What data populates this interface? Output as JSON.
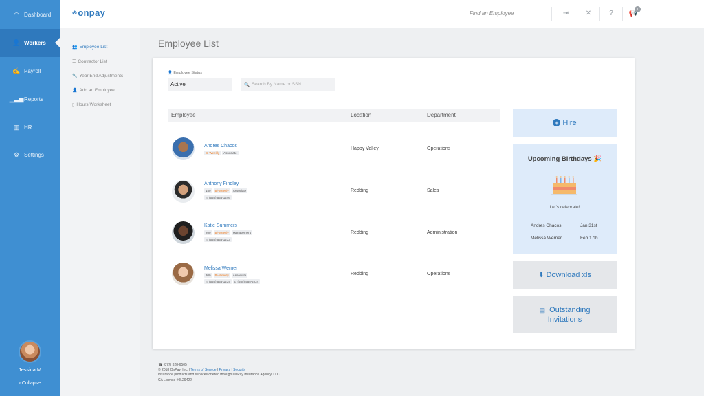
{
  "nav": {
    "items": [
      {
        "label": "Dashboard",
        "icon": "gauge-icon"
      },
      {
        "label": "Workers",
        "icon": "users-icon"
      },
      {
        "label": "Payroll",
        "icon": "payroll-icon"
      },
      {
        "label": "Reports",
        "icon": "chart-icon"
      },
      {
        "label": "HR",
        "icon": "books-icon"
      },
      {
        "label": "Settings",
        "icon": "gear-icon"
      }
    ],
    "active": "Workers",
    "user_name": "Jessica.M",
    "collapse_label": "«Collapse"
  },
  "subnav": {
    "items": [
      {
        "label": "Employee List",
        "icon": "users-icon"
      },
      {
        "label": "Contractor List",
        "icon": "list-icon"
      },
      {
        "label": "Year End Adjustments",
        "icon": "wrench-icon"
      },
      {
        "label": "Add an Employee",
        "icon": "user-plus-icon"
      },
      {
        "label": "Hours Worksheet",
        "icon": "file-icon"
      }
    ],
    "active": "Employee List"
  },
  "topbar": {
    "logo": "onpay",
    "search_placeholder": "Find an Employee",
    "notification_count": "1"
  },
  "main": {
    "title": "Employee List",
    "status_label": "Employee Status",
    "status_value": "Active",
    "search_placeholder": "Search By Name or SSN",
    "columns": [
      "Employee",
      "Location",
      "Department"
    ]
  },
  "employees": [
    {
      "name": "Andres Chacos",
      "tags": [
        "Bi-Weekly",
        "Associate"
      ],
      "phones": [],
      "location": "Happy Valley",
      "department": "Operations"
    },
    {
      "name": "Anthony Findley",
      "tags": [
        "150",
        "Bi-Weekly",
        "Associate"
      ],
      "phones": [
        "h: (555) 555-1246"
      ],
      "location": "Redding",
      "department": "Sales"
    },
    {
      "name": "Katie Summers",
      "tags": [
        "200",
        "Bi-Weekly",
        "Management"
      ],
      "phones": [
        "h: (555) 555-1233"
      ],
      "location": "Redding",
      "department": "Administration"
    },
    {
      "name": "Melissa Werner",
      "tags": [
        "300",
        "Bi-Weekly",
        "Associate"
      ],
      "phones": [
        "h: (555) 555-1234",
        "c: (555) 555-2224"
      ],
      "location": "Redding",
      "department": "Operations"
    }
  ],
  "widgets": {
    "hire_label": "Hire",
    "birthdays_title": "Upcoming Birthdays 🎉",
    "birthdays_sub": "Let's celebrate!",
    "birthdays": [
      {
        "name": "Andres Chacos",
        "date": "Jan 31st"
      },
      {
        "name": "Melissa Werner",
        "date": "Feb 17th"
      }
    ],
    "download_label": "Download xls",
    "invites_line1": "Outstanding",
    "invites_line2": "Invitations"
  },
  "footer": {
    "phone": "☎ (877) 328-6505",
    "copyright": "© 2018 OnPay, Inc. |",
    "links": [
      "Terms of Service",
      "Privacy",
      "Security"
    ],
    "line3": "Insurance products and services offered through OnPay Insurance Agency, LLC",
    "line4": "CA License #0L29422"
  },
  "colors": {
    "nav_bg": "#3f8fd2",
    "accent": "#2f79bd",
    "tag_orange": "#f07d20",
    "widget_blue": "#deebfa"
  }
}
